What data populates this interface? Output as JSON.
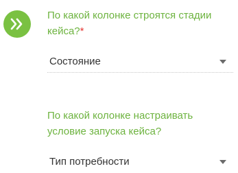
{
  "colors": {
    "accent": "#7ac142",
    "question_text": "#6db33f",
    "required": "#e53935",
    "value_text": "#333333"
  },
  "stage_icon": {
    "icon": "double-chevron-right-icon"
  },
  "fields": [
    {
      "question": "По какой колонке строятся стадии кейса?",
      "required_mark": "*",
      "selected": "Состояние"
    },
    {
      "question": "По какой колонке настраивать условие запуска кейса?",
      "selected": "Тип потребности"
    }
  ]
}
